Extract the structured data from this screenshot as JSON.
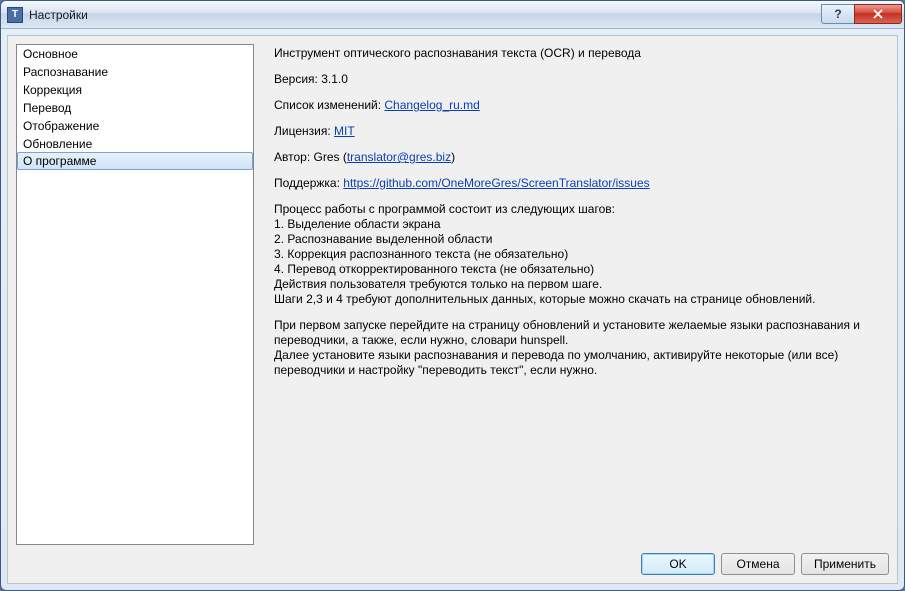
{
  "window": {
    "title": "Настройки",
    "app_icon_letter": "T"
  },
  "sidebar": {
    "items": [
      {
        "label": "Основное"
      },
      {
        "label": "Распознавание"
      },
      {
        "label": "Коррекция"
      },
      {
        "label": "Перевод"
      },
      {
        "label": "Отображение"
      },
      {
        "label": "Обновление"
      },
      {
        "label": "О программе"
      }
    ],
    "selected_index": 6
  },
  "about": {
    "description": "Инструмент оптического распознавания текста (OCR) и перевода",
    "version_label": "Версия: ",
    "version_value": "3.1.0",
    "changelog_label": "Список изменений: ",
    "changelog_link": "Changelog_ru.md",
    "license_label": "Лицензия: ",
    "license_link": "MIT",
    "author_label": "Автор: ",
    "author_name": "Gres (",
    "author_link": "translator@gres.biz",
    "author_close": ")",
    "support_label": "Поддержка: ",
    "support_link": "https://github.com/OneMoreGres/ScreenTranslator/issues",
    "steps_intro": "Процесс работы с программой состоит из следующих шагов:",
    "step1": "1. Выделение области экрана",
    "step2": "2. Распознавание выделенной области",
    "step3": "3. Коррекция распознанного текста (не обязательно)",
    "step4": "4. Перевод откорректированного текста (не обязательно)",
    "step_note1": "Действия пользователя требуются только на первом шаге.",
    "step_note2": "Шаги 2,3 и 4 требуют дополнительных данных, которые можно скачать на странице обновлений.",
    "first_run_1": "При первом запуске перейдите на страницу обновлений и установите желаемые языки распознавания и переводчики, а также, если нужно, словари hunspell.",
    "first_run_2": "Далее установите языки распознавания и перевода по умолчанию, активируйте некоторые (или все) переводчики и настройку \"переводить текст\", если нужно."
  },
  "buttons": {
    "ok": "OK",
    "cancel": "Отмена",
    "apply": "Применить"
  }
}
